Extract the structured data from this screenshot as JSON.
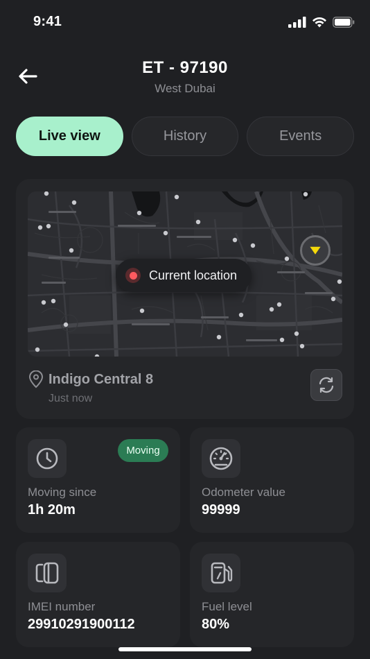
{
  "status_bar": {
    "time": "9:41"
  },
  "header": {
    "title": "ET - 97190",
    "subtitle": "West Dubai"
  },
  "tabs": [
    {
      "label": "Live view",
      "active": true
    },
    {
      "label": "History",
      "active": false
    },
    {
      "label": "Events",
      "active": false
    }
  ],
  "map": {
    "location_label": "Current location",
    "address": "Indigo Central 8",
    "updated": "Just now"
  },
  "stats": {
    "moving": {
      "badge": "Moving",
      "label": "Moving since",
      "value": "1h 20m",
      "icon": "clock-icon"
    },
    "odometer": {
      "label": "Odometer value",
      "value": "99999",
      "icon": "speedometer-icon"
    },
    "imei": {
      "label": "IMEI number",
      "value": "29910291900112",
      "icon": "device-icon"
    },
    "fuel": {
      "label": "Fuel level",
      "value": "80%",
      "icon": "fuel-pump-icon"
    }
  },
  "colors": {
    "background": "#1f2023",
    "card": "#252629",
    "accent_tab": "#a8f0cc",
    "moving_badge": "#2b7c54",
    "location_dot": "#ff5a5f",
    "vehicle_marker": "#f5d90a"
  }
}
